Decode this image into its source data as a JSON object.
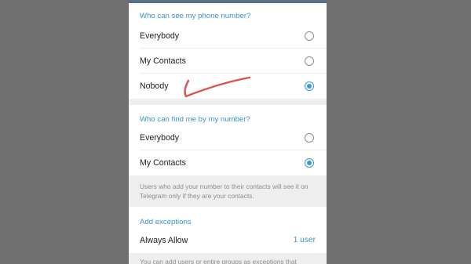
{
  "section1": {
    "header": "Who can see my phone number?",
    "options": [
      {
        "label": "Everybody",
        "selected": false
      },
      {
        "label": "My Contacts",
        "selected": false
      },
      {
        "label": "Nobody",
        "selected": true
      }
    ]
  },
  "section2": {
    "header": "Who can find me by my number?",
    "options": [
      {
        "label": "Everybody",
        "selected": false
      },
      {
        "label": "My Contacts",
        "selected": true
      }
    ],
    "info": "Users who add your number to their contacts will see it on Telegram only if they are your contacts."
  },
  "exceptions": {
    "header": "Add exceptions",
    "always_allow_label": "Always Allow",
    "always_allow_value": "1 user",
    "info": "You can add users or entire groups as exceptions that"
  },
  "colors": {
    "accent": "#3a95d2",
    "radio_checked": "#3b9ad9",
    "annotation": "#d9534f",
    "background": "#6f6f6f"
  },
  "icons": {
    "radio": "radio-button-icon",
    "annotation": "red-checkmark-annotation"
  }
}
